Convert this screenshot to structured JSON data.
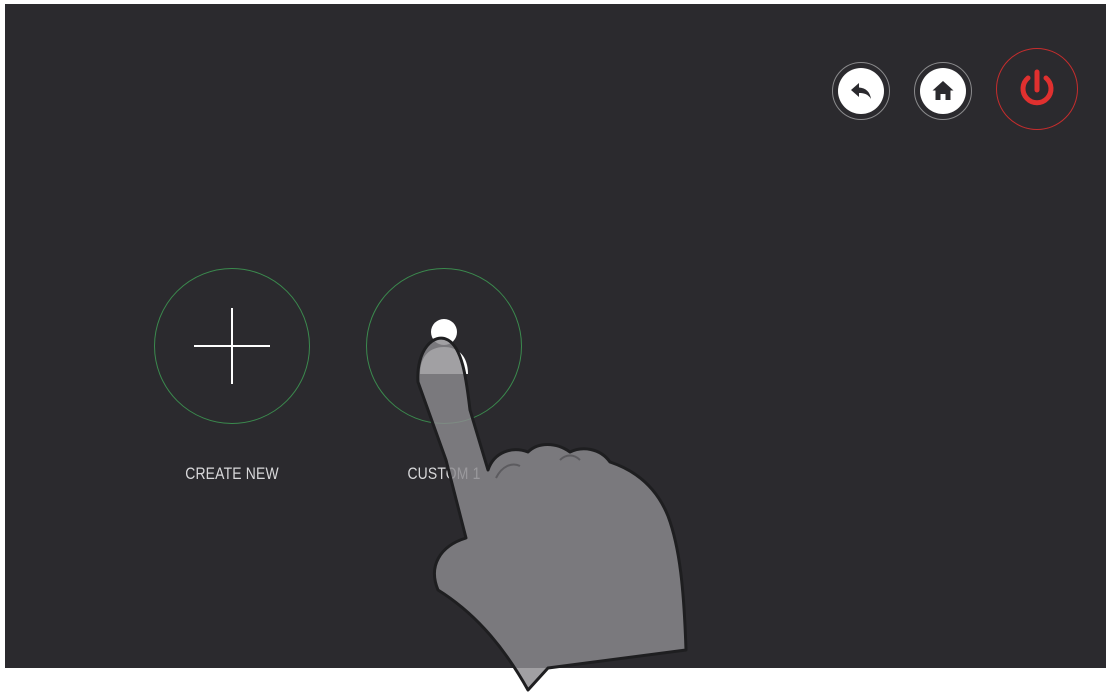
{
  "header": {
    "back_icon": "back-arrow-icon",
    "home_icon": "home-icon",
    "power_icon": "power-icon",
    "power_color": "#e0302f"
  },
  "profiles": {
    "items": [
      {
        "label": "CREATE NEW",
        "icon": "plus-icon"
      },
      {
        "label": "CUSTOM 1",
        "icon": "user-icon"
      }
    ],
    "ring_color": "#3b8a4e"
  },
  "overlay": {
    "gesture": "tap-hand-icon"
  },
  "colors": {
    "background": "#2b2a2e",
    "text": "#d8d8da"
  }
}
